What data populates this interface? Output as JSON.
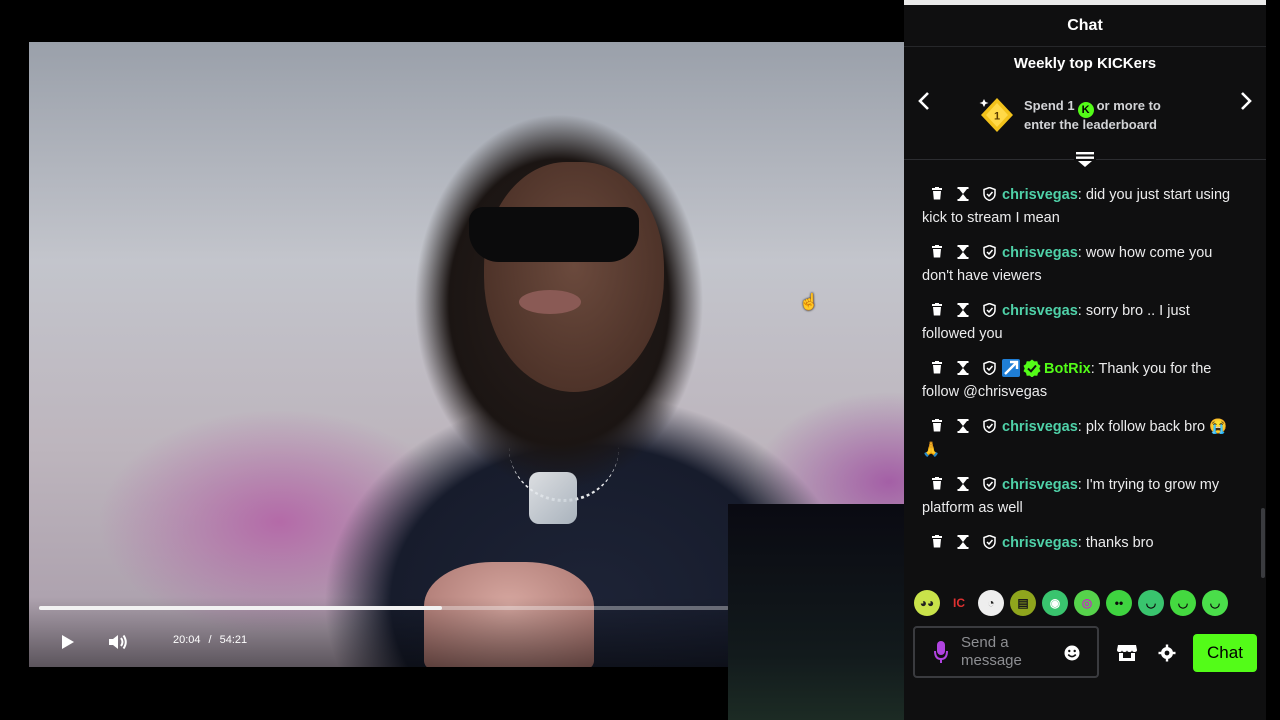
{
  "video": {
    "current_time": "20:04",
    "separator": "/",
    "duration": "54:21",
    "progress_fraction": 0.5846,
    "play_icon": "play-icon",
    "volume_icon": "volume-icon"
  },
  "chat": {
    "title": "Chat",
    "leaderboard": {
      "title": "Weekly top KICKers",
      "line1_prefix": "Spend 1",
      "line1_suffix": "or more to",
      "line2": "enter the leaderboard",
      "coin_label": "1",
      "k_label": "K"
    },
    "messages": [
      {
        "user": "chrisvegas",
        "color": "#4fd1a8",
        "text": "did you just start using kick to stream I mean",
        "badges": []
      },
      {
        "user": "chrisvegas",
        "color": "#4fd1a8",
        "text": "wow how come you don't have viewers",
        "badges": []
      },
      {
        "user": "chrisvegas",
        "color": "#4fd1a8",
        "text": "sorry bro .. I just followed you",
        "badges": []
      },
      {
        "user": "BotRix",
        "color": "#53fc18",
        "text": "Thank you for the follow @chrisvegas",
        "badges": [
          "bot-badge-icon",
          "verified-badge-icon"
        ]
      },
      {
        "user": "chrisvegas",
        "color": "#4fd1a8",
        "text": "plx follow back bro 😭🙏",
        "badges": []
      },
      {
        "user": "chrisvegas",
        "color": "#4fd1a8",
        "text": "I'm trying to grow my platform as well",
        "badges": []
      },
      {
        "user": "chrisvegas",
        "color": "#4fd1a8",
        "text": "thanks bro",
        "badges": []
      }
    ],
    "emotes": [
      "emote-1",
      "emote-ic",
      "emote-3",
      "emote-4",
      "emote-5",
      "emote-6",
      "emote-7",
      "emote-8",
      "emote-9",
      "emote-10"
    ],
    "emote_ic_label": "IC",
    "input_placeholder": "Send a message",
    "send_label": "Chat",
    "accent": "#53fc18",
    "username_color": "#4fd1a8"
  }
}
